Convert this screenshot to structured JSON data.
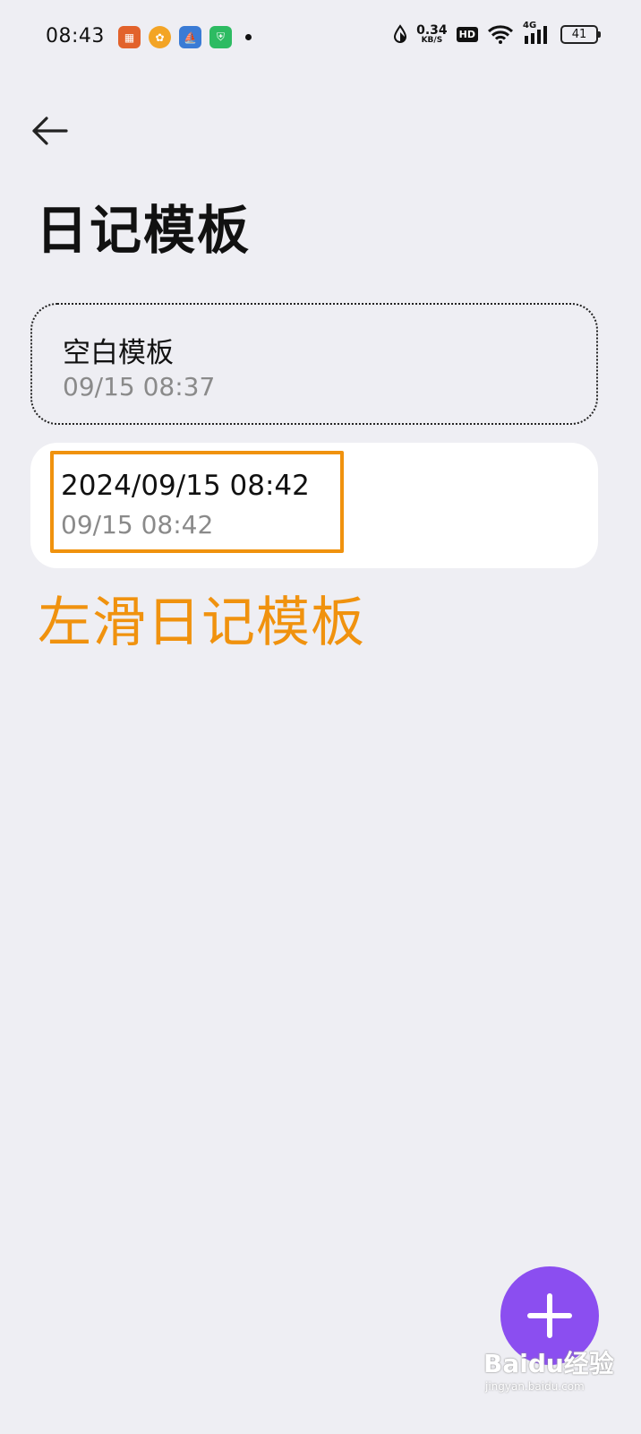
{
  "status_bar": {
    "time": "08:43",
    "net_speed_value": "0.34",
    "net_speed_unit": "KB/S",
    "hd": "HD",
    "signal_label": "4G",
    "battery": "41"
  },
  "header": {
    "title": "日记模板"
  },
  "templates": [
    {
      "title": "空白模板",
      "date": "09/15 08:37"
    },
    {
      "title": "2024/09/15 08:42",
      "date": "09/15 08:42"
    }
  ],
  "annotation": "左滑日记模板",
  "watermark": {
    "main": "Baidu经验",
    "sub": "jingyan.baidu.com"
  },
  "colors": {
    "accent": "#8b4ef0",
    "highlight": "#f0920e",
    "background": "#eeeef3"
  }
}
